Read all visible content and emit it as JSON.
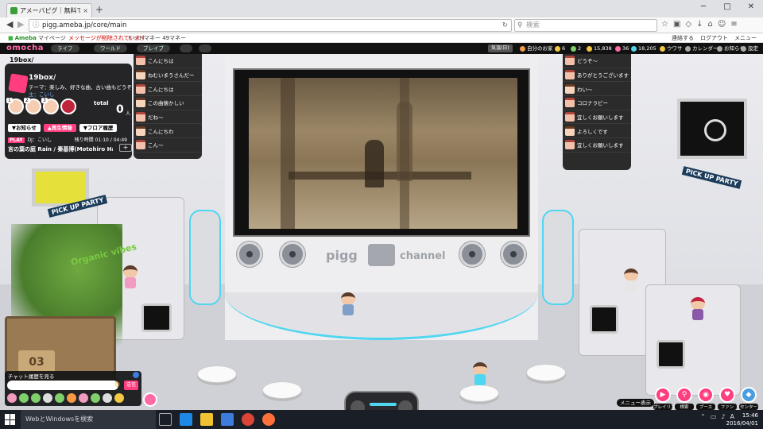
{
  "browser": {
    "tab_title": "アメーバピグ｜無料で遊べるアバター",
    "url": "pigg.ameba.jp/core/main",
    "search_placeholder": "検索"
  },
  "ameba_bar": {
    "logo": "Ameba",
    "mypage": "マイページ",
    "message": "メッセージが削除されています",
    "points": "ドットマネー 49マネー",
    "links": [
      "連絡する",
      "ログアウト",
      "メニュー"
    ]
  },
  "game_topbar": {
    "logo": "omocha",
    "nav": [
      "ライフ",
      "ワールド",
      "ブレイブ",
      "",
      ""
    ],
    "lantern": "気温(日)",
    "stats": [
      {
        "label": "自分のお家",
        "color": "#f39c4a"
      },
      {
        "label": "6",
        "color": "#f5c743"
      },
      {
        "label": "2",
        "color": "#7fcf6b"
      },
      {
        "label": "15,838",
        "color": "#f5c743"
      },
      {
        "label": "36",
        "color": "#ff6aa6"
      },
      {
        "label": "18,205",
        "color": "#4fd6f0"
      },
      {
        "label": "ウワサ",
        "color": "#f5c743"
      },
      {
        "label": "カレンダー",
        "color": "#aaaaaa"
      },
      {
        "label": "お知らせ",
        "color": "#aaaaaa"
      },
      {
        "label": "設定",
        "color": "#aaaaaa"
      }
    ]
  },
  "room": {
    "name": "19box/",
    "stage_brand": "pigg",
    "stage_channel": "channel",
    "pickup_left": "PICK UP PARTY",
    "pickup_right": "PICK UP PARTY",
    "organic": "Organic vibes",
    "crate_number": "03"
  },
  "box_panel": {
    "name": "19box/",
    "theme": "テーマ：楽しみ、好きな曲、古い曲もどうぞ",
    "owner": "主：こいし",
    "ranks": [
      "1",
      "2",
      "3"
    ],
    "total_label": "total",
    "total_count": "0",
    "total_unit": "人",
    "buttons": [
      "▼お知らせ",
      "▲再生情報",
      "▼フロア履歴"
    ],
    "play_tag": "PLAY",
    "dj": "DJ：こいし",
    "time": "残り時間 01:10 / 04:49",
    "song": "言の葉の庭 Rain / 秦基博(Motohiro Hata)"
  },
  "chat_left": [
    "こんにちは",
    "ねむいまうさんだー",
    "こんにちは",
    "この曲懐かしい",
    "だね〜",
    "こんにちわ",
    "こん〜"
  ],
  "chat_right": [
    "どうぞ〜",
    "ありがとうございます",
    "わい〜",
    "コロナラピー",
    "宜しくお願いします",
    "よろしくです",
    "宜しくお願いします"
  ],
  "chat_input": {
    "history_label": "チャット履歴を見る",
    "send": "送信"
  },
  "actions": {
    "menu_label": "メニュー表示",
    "buttons": [
      "プレイリスト",
      "検索",
      "ブース",
      "ファン",
      "センター"
    ]
  },
  "taskbar": {
    "search": "WebとWindowsを検索",
    "time": "15:46",
    "date": "2016/04/01"
  }
}
